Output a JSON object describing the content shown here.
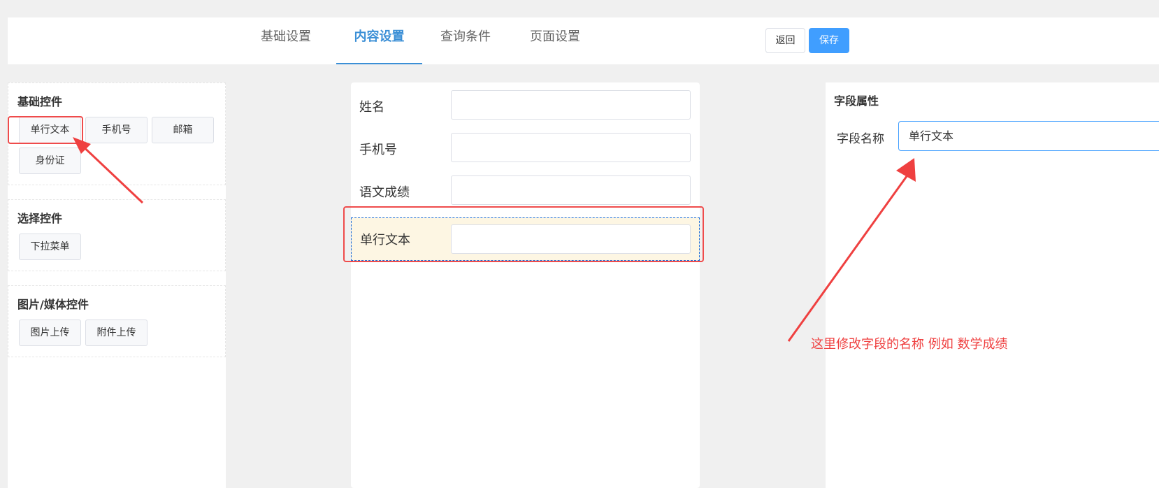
{
  "tabs": [
    {
      "label": "基础设置",
      "active": false
    },
    {
      "label": "内容设置",
      "active": true
    },
    {
      "label": "查询条件",
      "active": false
    },
    {
      "label": "页面设置",
      "active": false
    }
  ],
  "actions": {
    "back_label": "返回",
    "save_label": "保存"
  },
  "left_panel": {
    "groups": [
      {
        "title": "基础控件",
        "controls": [
          "单行文本",
          "手机号",
          "邮箱",
          "身份证"
        ]
      },
      {
        "title": "选择控件",
        "controls": [
          "下拉菜单"
        ]
      },
      {
        "title": "图片/媒体控件",
        "controls": [
          "图片上传",
          "附件上传"
        ]
      }
    ]
  },
  "form": {
    "fields": [
      {
        "label": "姓名",
        "value": ""
      },
      {
        "label": "手机号",
        "value": ""
      },
      {
        "label": "语文成绩",
        "value": ""
      },
      {
        "label": "单行文本",
        "value": "",
        "selected": true
      }
    ]
  },
  "properties": {
    "title": "字段属性",
    "field_name_label": "字段名称",
    "field_name_value": "单行文本"
  },
  "annotation": {
    "text": "这里修改字段的名称 例如 数学成绩",
    "color": "#ef4040"
  },
  "colors": {
    "accent": "#3b8fd6",
    "primary_button": "#409eff",
    "highlight": "#ef4b4b"
  }
}
